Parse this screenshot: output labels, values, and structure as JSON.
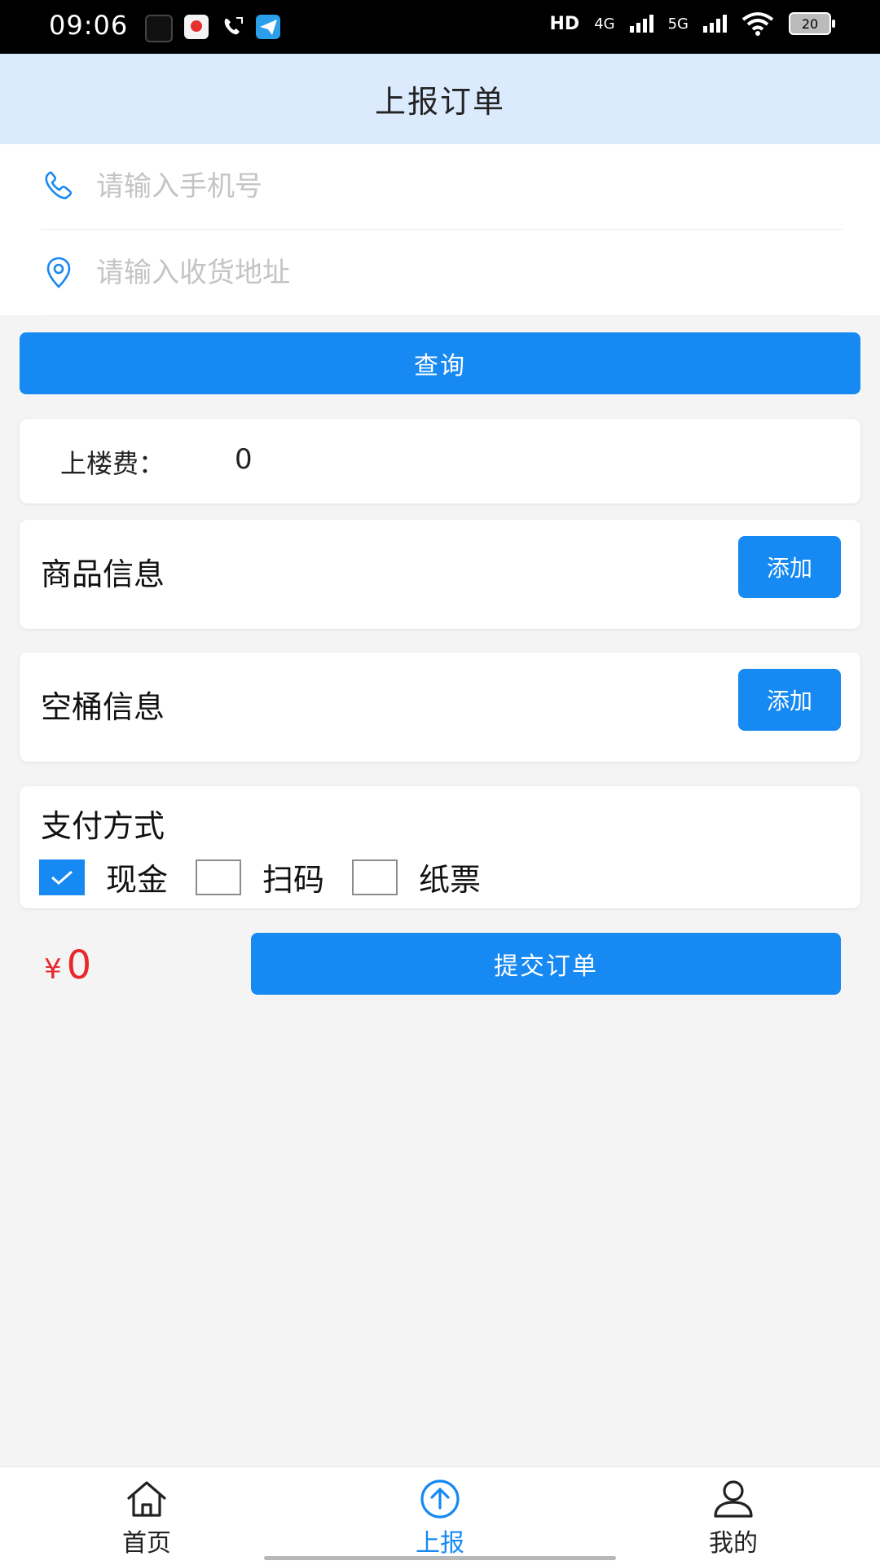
{
  "status_bar": {
    "time": "09:06",
    "hd_label": "HD",
    "network_4g": "4G",
    "network_5g": "5G",
    "battery": "20"
  },
  "header": {
    "title": "上报订单"
  },
  "form": {
    "phone_placeholder": "请输入手机号",
    "address_placeholder": "请输入收货地址",
    "query_label": "查询"
  },
  "fee": {
    "label": "上楼费：",
    "value": "0"
  },
  "goods": {
    "title": "商品信息",
    "add_label": "添加"
  },
  "buckets": {
    "title": "空桶信息",
    "add_label": "添加"
  },
  "payment": {
    "title": "支付方式",
    "options": [
      {
        "label": "现金",
        "checked": true
      },
      {
        "label": "扫码",
        "checked": false
      },
      {
        "label": "纸票",
        "checked": false
      }
    ]
  },
  "total": {
    "currency": "¥",
    "amount": "0"
  },
  "submit": {
    "label": "提交订单"
  },
  "bottom_nav": {
    "items": [
      {
        "label": "首页",
        "icon": "home-icon",
        "active": false
      },
      {
        "label": "上报",
        "icon": "upload-icon",
        "active": true
      },
      {
        "label": "我的",
        "icon": "user-icon",
        "active": false
      }
    ]
  },
  "colors": {
    "primary": "#1789f2",
    "header_bg": "#dbeafd",
    "price": "#e8282b",
    "page_bg": "#f4f4f4"
  }
}
